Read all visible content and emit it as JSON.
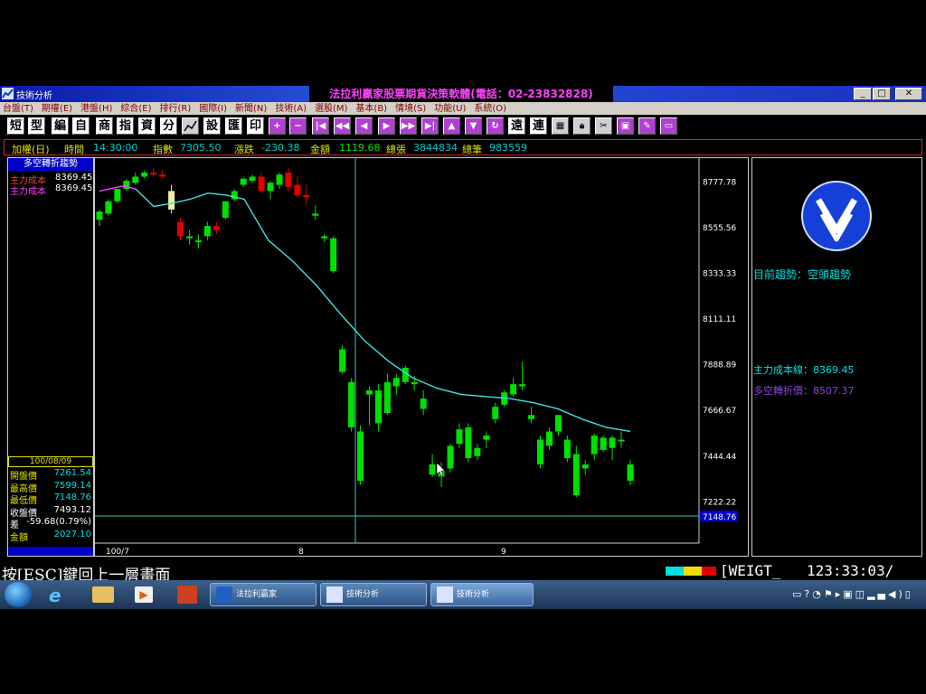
{
  "window": {
    "title": "技術分析",
    "banner": "法拉利贏家股票期貨決策軟體(電話：02-23832828)"
  },
  "menu": [
    "台盤(T)",
    "期權(E)",
    "港盤(H)",
    "綜合(E)",
    "排行(R)",
    "國際(I)",
    "新聞(N)",
    "技術(A)",
    "選股(M)",
    "基本(B)",
    "情境(S)",
    "功能(U)",
    "系統(O)"
  ],
  "toolbar": {
    "text_buttons": [
      "短",
      "型",
      "編",
      "自",
      "商",
      "指",
      "資",
      "分"
    ],
    "after_text_buttons": [
      "設",
      "匯",
      "印"
    ],
    "mid_text_buttons": [
      "遠",
      "連"
    ]
  },
  "info": {
    "symbol": "加權(日)",
    "time_label": "時間",
    "time_value": "14:30:00",
    "index_label": "指數",
    "index_value": "7305.50",
    "change_label": "漲跌",
    "change_value": "-230.38",
    "amount_label": "金額",
    "amount_value": "1119.68",
    "sheets_label": "總張",
    "sheets_value": "3844834",
    "trades_label": "總筆",
    "trades_value": "983559"
  },
  "left_panel": {
    "title": "多空轉折趨勢",
    "cost_rows": [
      {
        "label": "主力成本",
        "value": "8369.45↓"
      },
      {
        "label": "主力成本",
        "value": "8369.45↓"
      }
    ],
    "date": "100/08/09",
    "stats": [
      {
        "label": "開盤價",
        "value": "7261.54"
      },
      {
        "label": "最高價",
        "value": "7599.14"
      },
      {
        "label": "最低價",
        "value": "7148.76"
      },
      {
        "label": "收盤價",
        "value": "7493.12"
      },
      {
        "label": "差",
        "value": "-59.68(0.79%)"
      },
      {
        "label": "金額",
        "value": "2027.10"
      }
    ]
  },
  "right_panel": {
    "trend_label": "目前趨勢：空頭趨勢",
    "cost_line": "主力成本線：8369.45",
    "pivot_price": "多空轉折價：8507.37"
  },
  "status": {
    "hint": "按[ESC]鍵回上一層畫面",
    "tag": "[WEIGT_",
    "clock": "123:33:03/"
  },
  "taskbar": {
    "items": [
      "法拉利贏家",
      "技術分析",
      "技術分析"
    ]
  },
  "chart_data": {
    "type": "candlestick",
    "y_ticks": [
      "8777.78",
      "8555.56",
      "8333.33",
      "8111.11",
      "7888.89",
      "7666.67",
      "7444.44",
      "7222.22"
    ],
    "ylim": [
      7148.76,
      8890
    ],
    "current_marker": "7148.76",
    "x_ticks": [
      "100/7",
      "8",
      "9"
    ],
    "colors": {
      "up": "#00e000",
      "down": "#e00000",
      "neutral": "#f0f0a0",
      "ma_early": "#ff40ff",
      "ma": "#40e0e0"
    },
    "candles": [
      [
        8590,
        8640,
        8560,
        8630
      ],
      [
        8620,
        8690,
        8610,
        8680
      ],
      [
        8680,
        8740,
        8670,
        8740
      ],
      [
        8740,
        8790,
        8730,
        8780
      ],
      [
        8770,
        8820,
        8760,
        8800
      ],
      [
        8800,
        8830,
        8790,
        8820
      ],
      [
        8820,
        8840,
        8800,
        8810
      ],
      [
        8810,
        8830,
        8790,
        8800
      ],
      [
        8730,
        8760,
        8620,
        8640
      ],
      [
        8580,
        8600,
        8490,
        8510
      ],
      [
        8500,
        8540,
        8470,
        8510
      ],
      [
        8490,
        8520,
        8450,
        8490
      ],
      [
        8510,
        8580,
        8490,
        8560
      ],
      [
        8560,
        8580,
        8520,
        8540
      ],
      [
        8600,
        8680,
        8590,
        8680
      ],
      [
        8690,
        8740,
        8680,
        8730
      ],
      [
        8760,
        8800,
        8750,
        8790
      ],
      [
        8780,
        8810,
        8770,
        8800
      ],
      [
        8800,
        8820,
        8720,
        8730
      ],
      [
        8730,
        8780,
        8690,
        8770
      ],
      [
        8760,
        8820,
        8740,
        8810
      ],
      [
        8820,
        8840,
        8730,
        8750
      ],
      [
        8760,
        8800,
        8700,
        8710
      ],
      [
        8710,
        8760,
        8660,
        8700
      ],
      [
        8620,
        8660,
        8590,
        8610
      ],
      [
        8510,
        8520,
        8480,
        8500
      ],
      [
        8500,
        8510,
        8330,
        8340
      ],
      [
        7960,
        7980,
        7840,
        7850
      ],
      [
        7800,
        7820,
        7560,
        7580
      ],
      [
        7560,
        7590,
        7300,
        7320
      ],
      [
        7740,
        7780,
        7590,
        7760
      ],
      [
        7760,
        7790,
        7560,
        7600
      ],
      [
        7650,
        7840,
        7640,
        7800
      ],
      [
        7780,
        7840,
        7740,
        7820
      ],
      [
        7800,
        7880,
        7790,
        7870
      ],
      [
        7800,
        7830,
        7760,
        7790
      ],
      [
        7720,
        7760,
        7640,
        7670
      ],
      [
        7400,
        7450,
        7340,
        7350
      ],
      [
        7370,
        7410,
        7290,
        7340
      ],
      [
        7380,
        7500,
        7360,
        7490
      ],
      [
        7500,
        7600,
        7480,
        7570
      ],
      [
        7580,
        7600,
        7410,
        7430
      ],
      [
        7440,
        7500,
        7420,
        7480
      ],
      [
        7520,
        7560,
        7480,
        7540
      ],
      [
        7620,
        7700,
        7600,
        7680
      ],
      [
        7690,
        7760,
        7680,
        7750
      ],
      [
        7740,
        7820,
        7730,
        7790
      ],
      [
        7780,
        7900,
        7760,
        7790
      ],
      [
        7620,
        7680,
        7600,
        7640
      ],
      [
        7400,
        7540,
        7380,
        7520
      ],
      [
        7490,
        7580,
        7470,
        7560
      ],
      [
        7560,
        7640,
        7540,
        7640
      ],
      [
        7520,
        7540,
        7410,
        7430
      ],
      [
        7450,
        7490,
        7240,
        7250
      ],
      [
        7380,
        7420,
        7350,
        7400
      ],
      [
        7450,
        7550,
        7420,
        7540
      ],
      [
        7470,
        7540,
        7460,
        7530
      ],
      [
        7480,
        7540,
        7420,
        7530
      ],
      [
        7520,
        7560,
        7480,
        7520
      ],
      [
        7400,
        7420,
        7300,
        7320
      ]
    ],
    "ma_points": [
      [
        0,
        8730
      ],
      [
        8,
        8755
      ],
      [
        12,
        8740
      ],
      [
        18,
        8655
      ],
      [
        24,
        8670
      ],
      [
        30,
        8690
      ],
      [
        36,
        8720
      ],
      [
        42,
        8710
      ],
      [
        48,
        8690
      ],
      [
        56,
        8490
      ],
      [
        64,
        8390
      ],
      [
        72,
        8270
      ],
      [
        80,
        8130
      ],
      [
        88,
        8000
      ],
      [
        96,
        7900
      ],
      [
        104,
        7820
      ],
      [
        112,
        7770
      ],
      [
        120,
        7740
      ],
      [
        128,
        7730
      ],
      [
        136,
        7720
      ],
      [
        144,
        7700
      ],
      [
        152,
        7670
      ],
      [
        160,
        7620
      ],
      [
        168,
        7580
      ],
      [
        176,
        7560
      ]
    ]
  }
}
